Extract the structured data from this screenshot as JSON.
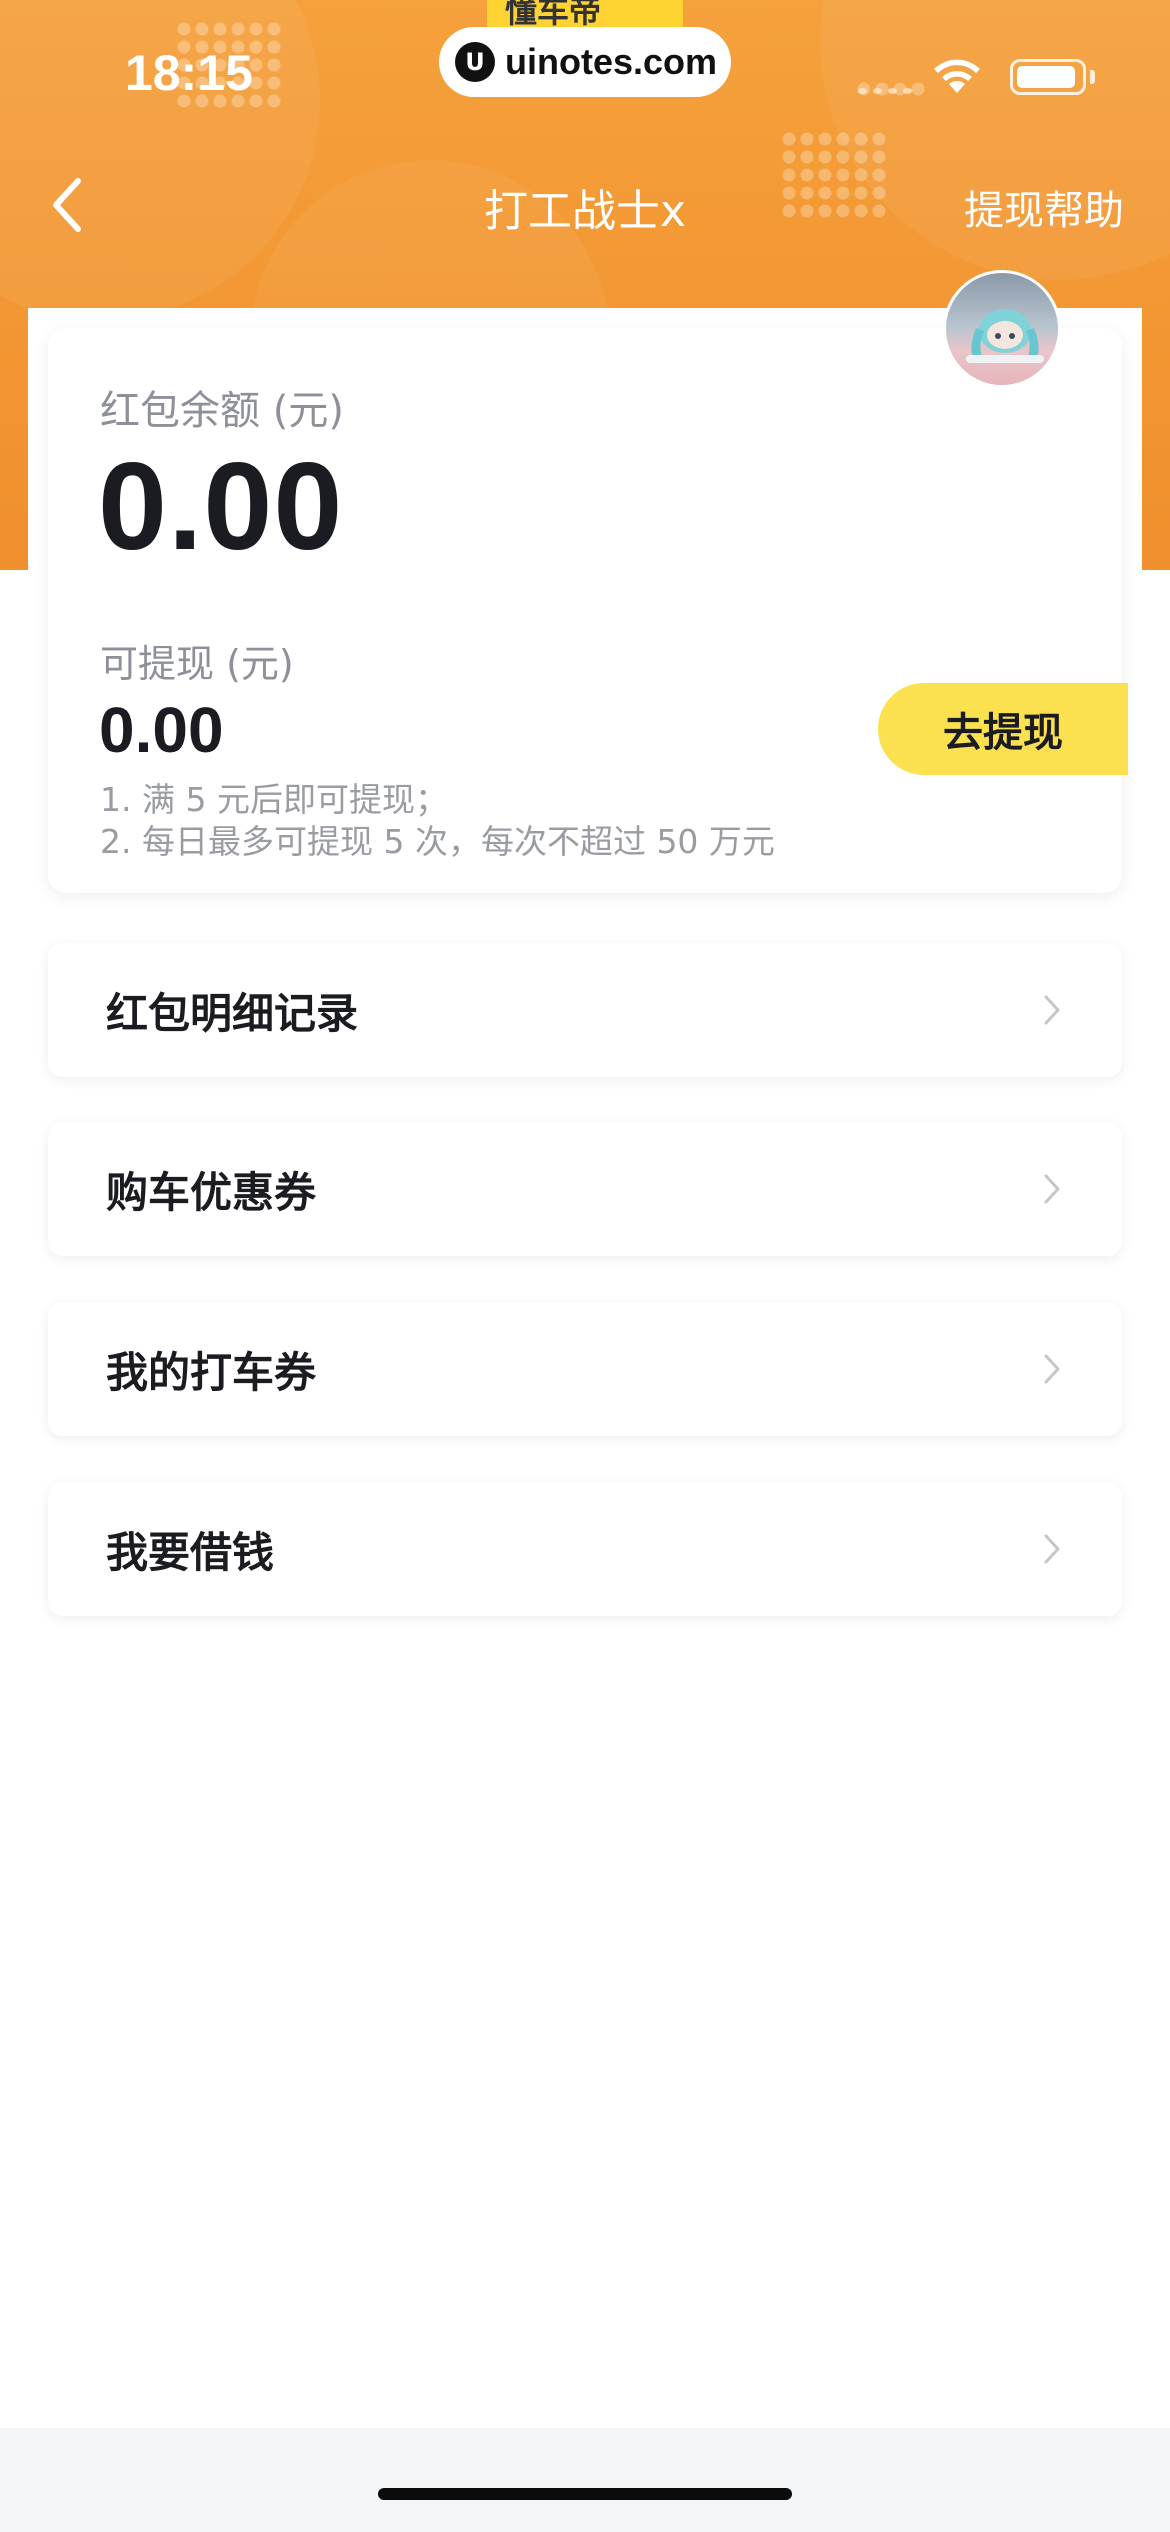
{
  "status_bar": {
    "time": "18:15",
    "watermark_tab": "懂车帝",
    "watermark_logo": "U",
    "watermark": "uinotes.com"
  },
  "nav": {
    "title": "打工战士x",
    "help": "提现帮助"
  },
  "balance_card": {
    "balance_label": "红包余额 (元)",
    "balance_value": "0.00",
    "withdrawable_label": "可提现 (元)",
    "withdrawable_value": "0.00",
    "rules": [
      "1. 满 5 元后即可提现；",
      "2. 每日最多可提现 5 次，每次不超过 50 万元"
    ],
    "withdraw_button": "去提现"
  },
  "menu": [
    {
      "label": "红包明细记录"
    },
    {
      "label": "购车优惠券"
    },
    {
      "label": "我的打车券"
    },
    {
      "label": "我要借钱"
    }
  ],
  "colors": {
    "header_orange": "#f29633",
    "button_yellow": "#fbe14f",
    "text_dark": "#1b1c22",
    "text_gray": "#8e9099"
  }
}
